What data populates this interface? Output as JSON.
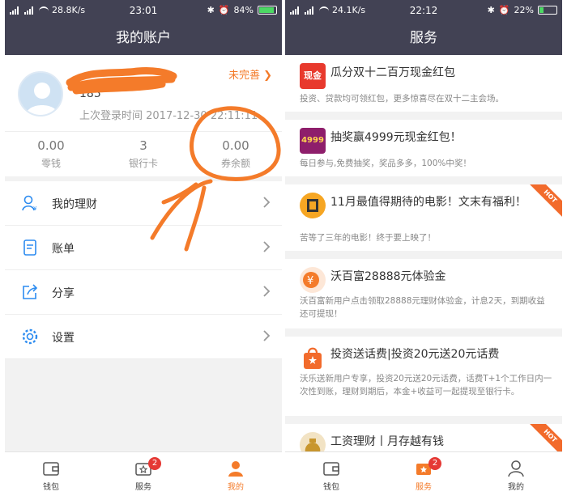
{
  "left": {
    "status": {
      "speed": "28.8K/s",
      "time": "23:01",
      "battery": "84%"
    },
    "title": "我的账户",
    "profile": {
      "phone_partial": "185",
      "last_login": "上次登录时间 2017-12-30 22:11:11",
      "incomplete_label": "未完善"
    },
    "stats": [
      {
        "value": "0.00",
        "label": "零钱"
      },
      {
        "value": "3",
        "label": "银行卡"
      },
      {
        "value": "0.00",
        "label": "券余额"
      }
    ],
    "menu": [
      {
        "label": "我的理财",
        "icon": "user-finance-icon"
      },
      {
        "label": "账单",
        "icon": "bill-icon"
      },
      {
        "label": "分享",
        "icon": "share-icon"
      },
      {
        "label": "设置",
        "icon": "gear-icon"
      }
    ],
    "tabs": [
      {
        "label": "钱包",
        "icon": "wallet-icon"
      },
      {
        "label": "服务",
        "icon": "service-icon",
        "badge": "2"
      },
      {
        "label": "我的",
        "icon": "person-icon"
      }
    ]
  },
  "right": {
    "status": {
      "speed": "24.1K/s",
      "time": "22:12",
      "battery": "22%"
    },
    "title": "服务",
    "cards": [
      {
        "title": "瓜分双十二百万现金红包",
        "desc": "投资、贷款均可领红包，更多惊喜尽在双十二主会场。",
        "icon_text": "现金"
      },
      {
        "title": "抽奖赢4999元现金红包！",
        "desc": "每日参与,免费抽奖，奖品多多，100%中奖！",
        "icon_text": "4999"
      },
      {
        "title": "11月最值得期待的电影！文末有福利！",
        "desc": "苦等了三年的电影！终于要上映了！",
        "hot": "HOT"
      },
      {
        "title": "沃百富28888元体验金",
        "desc": "沃百富新用户点击领取28888元理财体验金，计息2天，到期收益还可提现！"
      },
      {
        "title": "投资送话费|投资20元送20元话费",
        "desc": "沃乐送新用户专享，投资20元送20元话费，话费T+1个工作日内一次性到账，理财到期后，本金+收益可一起提现至银行卡。"
      },
      {
        "title": "工资理财丨月存越有钱",
        "hot": "HOT"
      }
    ],
    "tabs": [
      {
        "label": "钱包",
        "icon": "wallet-icon"
      },
      {
        "label": "服务",
        "icon": "service-icon",
        "badge": "2"
      },
      {
        "label": "我的",
        "icon": "person-icon"
      }
    ]
  },
  "colors": {
    "header": "#424254",
    "accent": "#f47b2a",
    "badge": "#e53935"
  }
}
